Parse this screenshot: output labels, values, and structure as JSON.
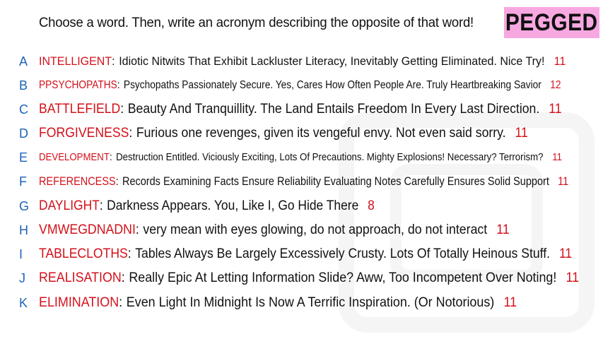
{
  "prompt": "Choose a word. Then, write an acronym describing the opposite of that word!",
  "logo": "PEGGED",
  "colors": {
    "letter": "#1e63b8",
    "word": "#d4101a",
    "count": "#d4101a",
    "logo_bg": "#f8a8e0"
  },
  "answers": [
    {
      "letter": "A",
      "word": "INTELLIGENT",
      "phrase": "Idiotic Nitwits That Exhibit Lackluster Literacy, Inevitably Getting Eliminated. Nice Try!",
      "count": "11"
    },
    {
      "letter": "B",
      "word": "PPSYCHOPATHS",
      "phrase": "Psychopaths Passionately Secure. Yes, Cares How Often People Are. Truly Heartbreaking Savior",
      "count": "12"
    },
    {
      "letter": "C",
      "word": "BATTLEFIELD",
      "phrase": "Beauty And Tranquillity. The Land Entails Freedom In Every Last Direction.",
      "count": "11"
    },
    {
      "letter": "D",
      "word": "FORGIVENESS",
      "phrase": "Furious one revenges, given its vengeful envy. Not even said sorry.",
      "count": "11"
    },
    {
      "letter": "E",
      "word": "DEVELOPMENT",
      "phrase": "Destruction Entitled. Viciously Exciting, Lots Of Precautions. Mighty Explosions! Necessary? Terrorism?",
      "count": "11"
    },
    {
      "letter": "F",
      "word": "REFERENCESS",
      "phrase": "Records Examining Facts Ensure Reliability Evaluating Notes Carefully Ensures Solid Support",
      "count": "11"
    },
    {
      "letter": "G",
      "word": "DAYLIGHT",
      "phrase": "Darkness Appears. You, Like I, Go Hide There",
      "count": "8"
    },
    {
      "letter": "H",
      "word": "VMWEGDNADNI",
      "phrase": "very mean with eyes glowing, do not approach, do not interact",
      "count": "11"
    },
    {
      "letter": "I",
      "word": "TABLECLOTHS",
      "phrase": "Tables Always Be Largely Excessively Crusty. Lots Of Totally Heinous Stuff.",
      "count": "11"
    },
    {
      "letter": "J",
      "word": "REALISATION",
      "phrase": "Really Epic At Letting Information Slide? Aww, Too Incompetent Over Noting!",
      "count": "11"
    },
    {
      "letter": "K",
      "word": "ELIMINATION",
      "phrase": "Even Light In Midnight Is Now A Terrific Inspiration. (Or Notorious)",
      "count": "11"
    }
  ]
}
